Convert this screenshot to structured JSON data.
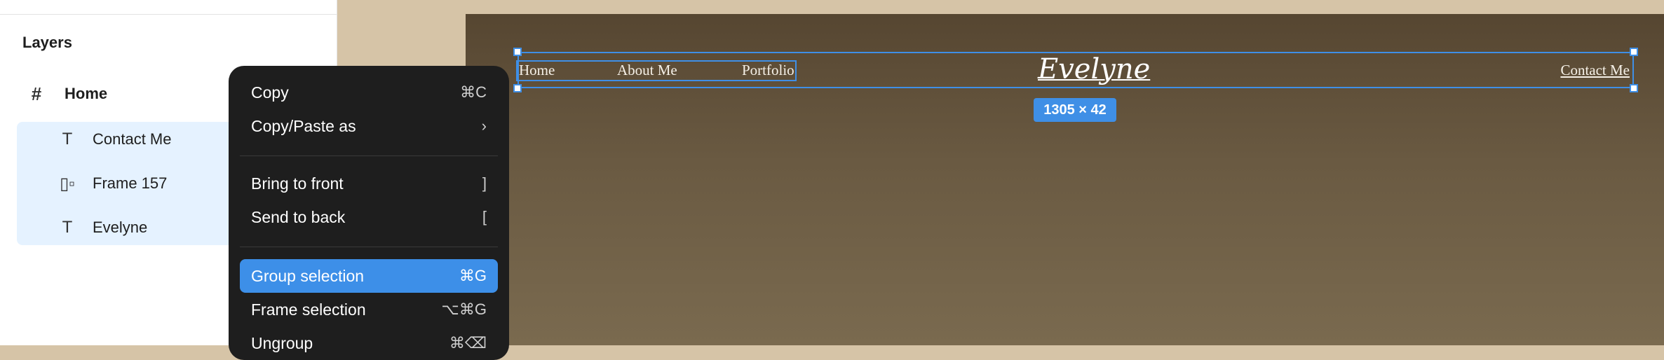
{
  "layers": {
    "title": "Layers",
    "root": {
      "label": "Home",
      "icon": "frame-icon"
    },
    "children": [
      {
        "label": "Contact Me",
        "icon": "text-icon"
      },
      {
        "label": "Frame 157",
        "icon": "autolayout-frame-icon"
      },
      {
        "label": "Evelyne",
        "icon": "text-icon"
      }
    ]
  },
  "context_menu": {
    "items": [
      {
        "label": "Copy",
        "shortcut": "⌘C"
      },
      {
        "label": "Copy/Paste as",
        "shortcut": "›"
      },
      {
        "label": "Bring to front",
        "shortcut": "]"
      },
      {
        "label": "Send to back",
        "shortcut": "["
      },
      {
        "label": "Group selection",
        "shortcut": "⌘G",
        "active": true
      },
      {
        "label": "Frame selection",
        "shortcut": "⌥⌘G"
      },
      {
        "label": "Ungroup",
        "shortcut": "⌘⌫"
      }
    ]
  },
  "canvas": {
    "nav": {
      "home": "Home",
      "about": "About Me",
      "portfolio": "Portfolio",
      "contact": "Contact Me"
    },
    "brand": "Evelyne",
    "selection_size": "1305 × 42"
  },
  "colors": {
    "selection": "#3f8fe6",
    "panel_bg": "#ffffff",
    "menu_bg": "#1e1e1e",
    "canvas_bg": "#d6c4a7"
  }
}
